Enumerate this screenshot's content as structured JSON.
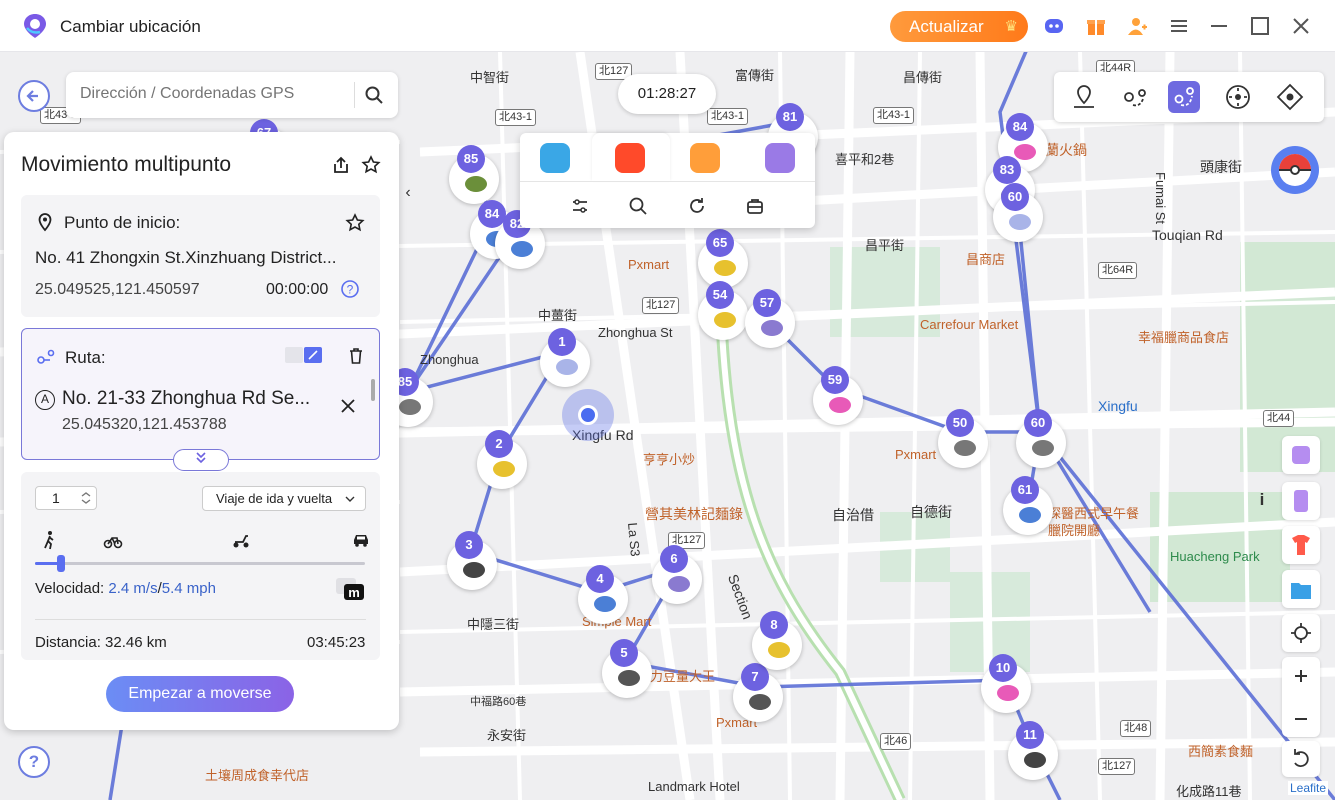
{
  "app": {
    "title": "Cambiar ubicación",
    "upgrade_label": "Actualizar"
  },
  "search": {
    "placeholder": "Dirección / Coordenadas GPS"
  },
  "timer": "01:28:27",
  "panel": {
    "title": "Movimiento multipunto",
    "start": {
      "label": "Punto de inicio:",
      "address": "No. 41 Zhongxin St.Xinzhuang District...",
      "coords": "25.049525,121.450597",
      "time": "00:00:00"
    },
    "route": {
      "label": "Ruta:",
      "point_letter": "A",
      "point_address": "No. 21-33 Zhonghua Rd Se...",
      "point_coords": "25.045320,121.453788"
    },
    "settings": {
      "repeat_count": "1",
      "mode_selected": "Viaje de ida y vuelta",
      "speed_slider_fraction": 0.08,
      "speed_label": "Velocidad:",
      "speed_ms": "2.4 m/s",
      "speed_sep": "/",
      "speed_mph": "5.4 mph",
      "distance": "Distancia: 32.46 km",
      "duration": "03:45:23"
    },
    "start_button": "Empezar a moverse"
  },
  "map": {
    "road_badges": [
      "北127",
      "北43-1",
      "北43-1",
      "北43-1",
      "北127",
      "北127",
      "北64R",
      "北44",
      "北46",
      "北48",
      "北43-1",
      "北44R",
      "北127"
    ],
    "labels": [
      {
        "text": "中智街",
        "cls": ""
      },
      {
        "text": "富傳街",
        "cls": ""
      },
      {
        "text": "昌傳街",
        "cls": ""
      },
      {
        "text": "喜平和2巷",
        "cls": ""
      },
      {
        "text": "蘭火鍋",
        "cls": "poi"
      },
      {
        "text": "Fumai St",
        "cls": ""
      },
      {
        "text": "頭康街",
        "cls": ""
      },
      {
        "text": "昌平街",
        "cls": ""
      },
      {
        "text": "昌商店",
        "cls": "poi"
      },
      {
        "text": "Touqian Rd",
        "cls": "big"
      },
      {
        "text": "Pxmart",
        "cls": "poi"
      },
      {
        "text": "中薑街",
        "cls": ""
      },
      {
        "text": "Zhonghua St",
        "cls": ""
      },
      {
        "text": "Carrefour Market",
        "cls": "poi"
      },
      {
        "text": "幸福臘商品食店",
        "cls": "poi"
      },
      {
        "text": "Xingfu",
        "cls": "blue"
      },
      {
        "text": "Xingfu Rd",
        "cls": "big"
      },
      {
        "text": "亨亨小炒",
        "cls": "poi"
      },
      {
        "text": "Pxmart",
        "cls": "poi"
      },
      {
        "text": "營其美林記麵錄",
        "cls": "poi"
      },
      {
        "text": "自治借",
        "cls": ""
      },
      {
        "text": "自德街",
        "cls": ""
      },
      {
        "text": "探醫西式早午餐臘院開廳",
        "cls": "poi"
      },
      {
        "text": "Huacheng Park",
        "cls": "green"
      },
      {
        "text": "中隱三街",
        "cls": ""
      },
      {
        "text": "Simple Mart",
        "cls": "poi"
      },
      {
        "text": "力豆量大王",
        "cls": "poi"
      },
      {
        "text": "Pxmart",
        "cls": "poi"
      },
      {
        "text": "中福路60巷",
        "cls": ""
      },
      {
        "text": "永安街",
        "cls": ""
      },
      {
        "text": "西簡素食麵",
        "cls": "poi"
      },
      {
        "text": "土壤周成食幸代店",
        "cls": "poi"
      },
      {
        "text": "Landmark Hotel",
        "cls": ""
      },
      {
        "text": "化成路11巷",
        "cls": ""
      },
      {
        "text": "Section",
        "cls": ""
      },
      {
        "text": "La S3",
        "cls": ""
      },
      {
        "text": "Zhonghua",
        "cls": ""
      }
    ],
    "markers": [
      "85",
      "84",
      "82",
      "67",
      "85",
      "1",
      "2",
      "3",
      "4",
      "6",
      "5",
      "7",
      "8",
      "65",
      "54",
      "57",
      "59",
      "81",
      "84",
      "83",
      "60",
      "50",
      "60",
      "61",
      "10",
      "11"
    ]
  },
  "attribution": "Leafite"
}
